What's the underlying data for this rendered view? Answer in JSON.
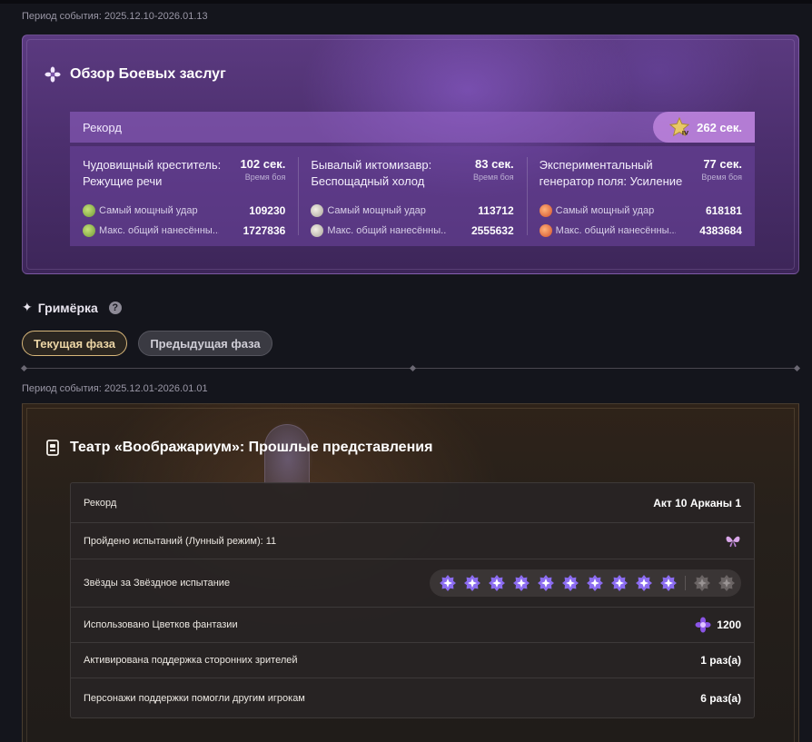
{
  "top_period": "Период события:  2025.12.10-2026.01.13",
  "merits": {
    "title": "Обзор Боевых заслуг",
    "record_label": "Рекорд",
    "record_value": "262 сек.",
    "bosses": [
      {
        "name": "Чудовищный креститель: Режущие речи",
        "time": "102 сек.",
        "time_label": "Время боя",
        "stats": [
          {
            "icon": "dendro-icon",
            "label": "Самый мощный удар",
            "value": "109230"
          },
          {
            "icon": "dendro-icon",
            "label": "Макс. общий нанесённы...",
            "value": "1727836"
          }
        ]
      },
      {
        "name": "Бывалый иктомизавр: Беспощадный холод",
        "time": "83 сек.",
        "time_label": "Время боя",
        "stats": [
          {
            "icon": "skull-icon",
            "label": "Самый мощный удар",
            "value": "113712"
          },
          {
            "icon": "skull-icon",
            "label": "Макс. общий нанесённы...",
            "value": "2555632"
          }
        ]
      },
      {
        "name": "Экспериментальный генератор поля: Усиление",
        "time": "77 сек.",
        "time_label": "Время боя",
        "stats": [
          {
            "icon": "fire-icon",
            "label": "Самый мощный удар",
            "value": "618181"
          },
          {
            "icon": "fire-icon",
            "label": "Макс. общий нанесённы...",
            "value": "4383684"
          }
        ]
      }
    ]
  },
  "dressing": {
    "title": "Гримёрка",
    "help": "?",
    "tab_current": "Текущая фаза",
    "tab_previous": "Предыдущая фаза"
  },
  "bottom_period": "Период события: 2025.12.01-2026.01.01",
  "theater": {
    "title": "Театр «Воображариум»: Прошлые представления",
    "rows": {
      "record": {
        "label": "Рекорд",
        "value": "Акт 10  Арканы 1"
      },
      "trials": {
        "label": "Пройдено испытаний (Лунный режим): 11"
      },
      "stars": {
        "label": "Звёзды за Звёздное испытание",
        "earned": 10,
        "total": 12
      },
      "flowers": {
        "label": "Использовано Цветков фантазии",
        "value": "1200"
      },
      "support": {
        "label": "Активирована поддержка сторонних зрителей",
        "value": "1 раз(а)"
      },
      "helped": {
        "label": "Персонажи поддержки помогли другим игрокам",
        "value": "6 раз(а)"
      }
    }
  },
  "colors": {
    "merits_bg": "#4c2f6e",
    "record_badge": "#c88ce6",
    "tab_active_border": "#d8b77a",
    "star_active": "#8b6cf0"
  }
}
